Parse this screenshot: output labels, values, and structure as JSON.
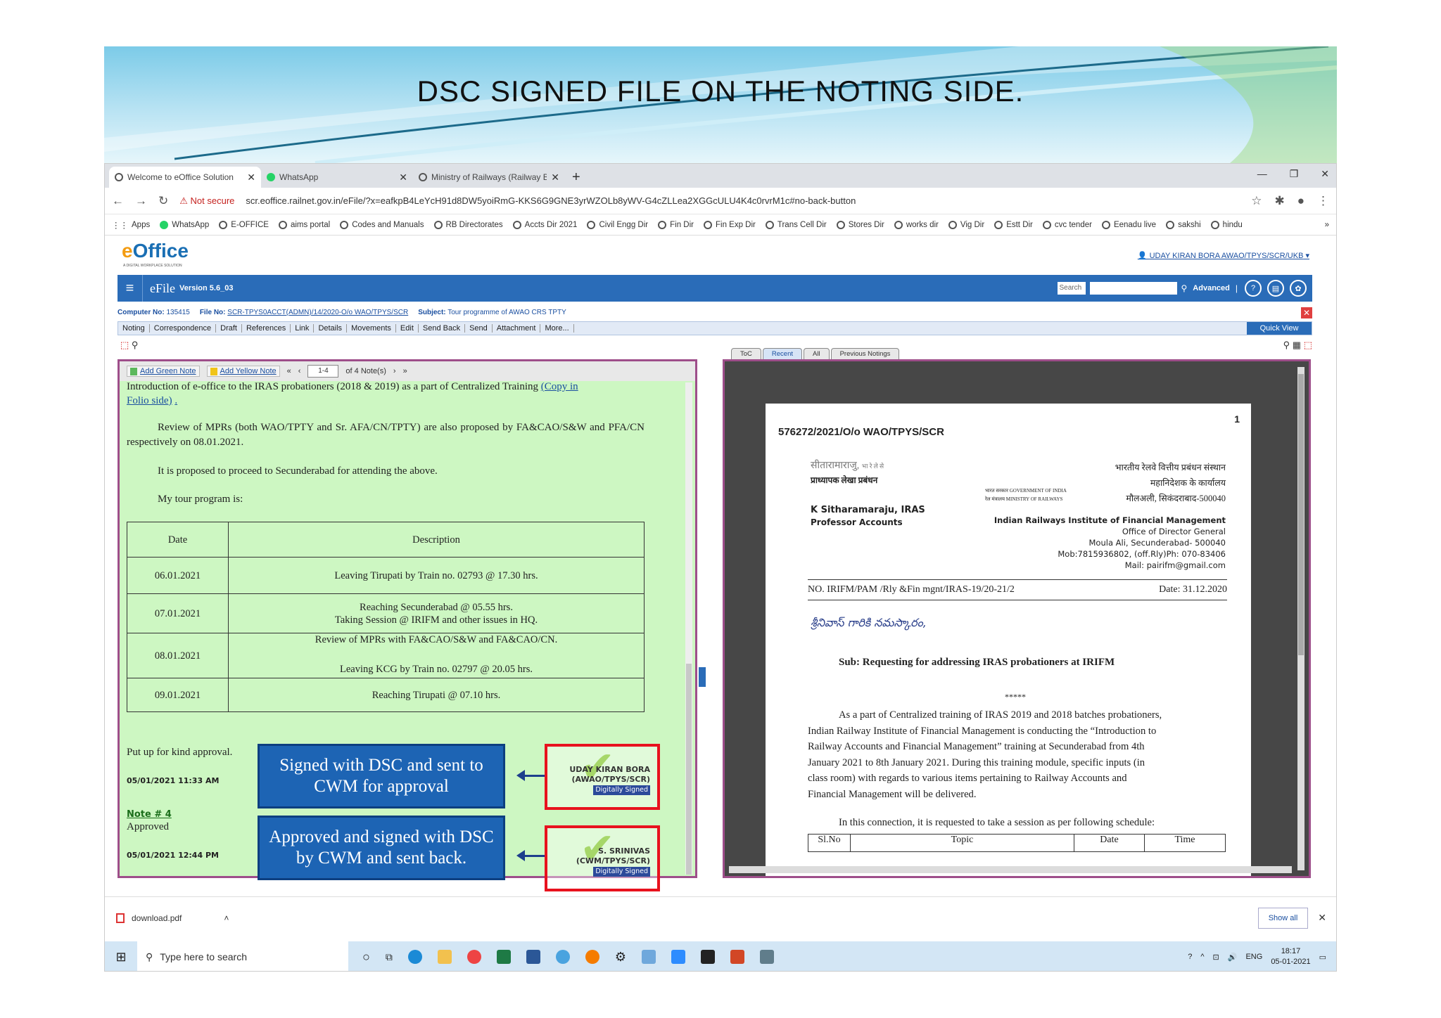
{
  "slide": {
    "title": "DSC SIGNED FILE ON THE NOTING SIDE."
  },
  "browser": {
    "tabs": [
      {
        "label": "Welcome to eOffice Solution",
        "icon": "globe-icon"
      },
      {
        "label": "WhatsApp",
        "icon": "whatsapp-icon"
      },
      {
        "label": "Ministry of Railways (Railway Boa",
        "icon": "globe-icon"
      }
    ],
    "not_secure": "Not secure",
    "url": "scr.eoffice.railnet.gov.in/eFile/?x=eafkpB4LeYcH91d8DW5yoiRmG-KKS6G9GNE3yrWZOLb8yWV-G4cZLLea2XGGcULU4K4c0rvrM1c#no-back-button",
    "bookmarks": [
      "Apps",
      "WhatsApp",
      "E-OFFICE",
      "aims portal",
      "Codes and Manuals",
      "RB Directorates",
      "Accts Dir 2021",
      "Civil Engg Dir",
      "Fin Dir",
      "Fin Exp Dir",
      "Trans Cell Dir",
      "Stores Dir",
      "works dir",
      "Vig Dir",
      "Estt Dir",
      "cvc tender",
      "Eenadu live",
      "sakshi",
      "hindu"
    ],
    "bookmarks_more": "»"
  },
  "efile": {
    "logo_e": "e",
    "logo_rest": "Office",
    "logo_sub": "A DIGITAL WORKPLACE SOLUTION",
    "user": "UDAY KIRAN BORA  AWAO/TPYS/SCR/UKB",
    "title": "eFile",
    "version": "Version 5.6_03",
    "search_label": "Search",
    "advanced": "Advanced",
    "computer_no_label": "Computer No:",
    "computer_no": "135415",
    "file_no_label": "File No:",
    "file_no": "SCR-TPYS0ACCT(ADMN)/14/2020-O/o WAO/TPYS/SCR",
    "subject_label": "Subject:",
    "subject": "Tour programme of AWAO CRS TPTY",
    "menu": [
      "Noting",
      "Correspondence",
      "Draft",
      "References",
      "Link",
      "Details",
      "Movements",
      "Edit",
      "Send Back",
      "Send",
      "Attachment",
      "More..."
    ],
    "quick_view": "Quick View",
    "doc_tabs": [
      "ToC",
      "Recent",
      "All",
      "Previous Notings"
    ]
  },
  "notes": {
    "add_green": "Add Green Note",
    "add_yellow": "Add Yellow Note",
    "pager_value": "1-4",
    "pager_total": "of 4 Note(s)",
    "intro_cut": "Introduction of e-office  to the IRAS probationers (2018 & 2019) as a part of Centralized Training",
    "copy_link_1": "(Copy in",
    "copy_link_2": "Folio side)",
    "para_review": "Review of MPRs (both WAO/TPTY and Sr. AFA/CN/TPTY) are also proposed by FA&CAO/S&W and PFA/CN respectively on 08.01.2021.",
    "para_proceed": "It is proposed to proceed to Secunderabad for attending the above.",
    "para_program": "My tour program is:",
    "table": {
      "headers": [
        "Date",
        "Description"
      ],
      "rows": [
        {
          "date": "06.01.2021",
          "desc": "Leaving Tirupati by Train no. 02793 @ 17.30 hrs."
        },
        {
          "date": "07.01.2021",
          "desc": "Reaching Secunderabad @ 05.55 hrs.",
          "desc2": "Taking Session @ IRIFM and other issues in HQ."
        },
        {
          "date": "08.01.2021",
          "desc": "Review of MPRs with FA&CAO/S&W and FA&CAO/CN.",
          "desc2": "Leaving KCG by Train no. 02797 @ 20.05 hrs."
        },
        {
          "date": "09.01.2021",
          "desc": "Reaching Tirupati @ 07.10 hrs."
        }
      ]
    },
    "approval_text": "Put up for kind approval.",
    "timestamp_1": "05/01/2021 11:33 AM",
    "note_link": "Note # 4",
    "approved": "Approved",
    "timestamp_2": "05/01/2021 12:44 PM",
    "sig1_name": "UDAY KIRAN BORA",
    "sig1_desig": "(AWAO/TPYS/SCR)",
    "sig2_name": "S. SRINIVAS",
    "sig2_desig": "(CWM/TPYS/SCR)",
    "digitally_signed": "Digitally Signed"
  },
  "callouts": {
    "c1": "Signed with DSC and sent to CWM for approval",
    "c2": "Approved and signed with DSC by CWM and sent back."
  },
  "pdf": {
    "page_no": "1",
    "ref": "576272/2021/O/o WAO/TPYS/SCR",
    "hindi_name": "सीतारामाराजु,",
    "hindi_name_suffix": "भा रे ले से",
    "hindi_prof": "प्राध्यापक लेखा प्रबंधन",
    "hindi_inst": "भारतीय रेलवे वित्तीय प्रबंधन संस्थान",
    "hindi_office": "महानिदेशक के कार्यालय",
    "hindi_addr": "मौलअली, सिकंदराबाद-500040",
    "gov_1": "भारत सरकार GOVERNMENT OF INDIA",
    "gov_2": "रेल मंत्रालय MINISTRY OF RAILWAYS",
    "name": "K Sitharamaraju, IRAS",
    "designation": "Professor Accounts",
    "inst": "Indian Railways Institute of Financial Management",
    "office": "Office of Director General",
    "address": "Moula Ali, Secunderabad- 500040",
    "contact": "Mob:7815936802, (off.Rly)Ph: 070-83406",
    "mail": "Mail: pairifm@gmail.com",
    "letter_no": "NO. IRIFM/PAM /Rly &Fin mgnt/IRAS-19/20-21/2",
    "date": "Date: 31.12.2020",
    "salutation": "శ్రీనివాస్ గారికి నమస్కారం,",
    "subject": "Sub: Requesting for addressing IRAS probationers at IRIFM",
    "stars": "*****",
    "body_lines": [
      "As a part of Centralized training of IRAS 2019 and 2018 batches probationers,",
      "Indian Railway Institute of Financial Management is conducting the “Introduction to",
      "Railway Accounts and Financial Management” training at Secunderabad from 4th",
      "January 2021 to 8th January 2021. During this training module, specific inputs (in",
      "class room) with regards to various items pertaining to Railway Accounts and",
      "Financial Management will be delivered."
    ],
    "body_2": "In this connection, it is requested to take a session as per following schedule:",
    "table_headers": [
      "Sl.No",
      "Topic",
      "Date",
      "Time"
    ]
  },
  "downloads": {
    "file": "download.pdf",
    "show_all": "Show all"
  },
  "taskbar": {
    "search": "Type here to search",
    "lang": "ENG",
    "time": "18:17",
    "date": "05-01-2021"
  }
}
